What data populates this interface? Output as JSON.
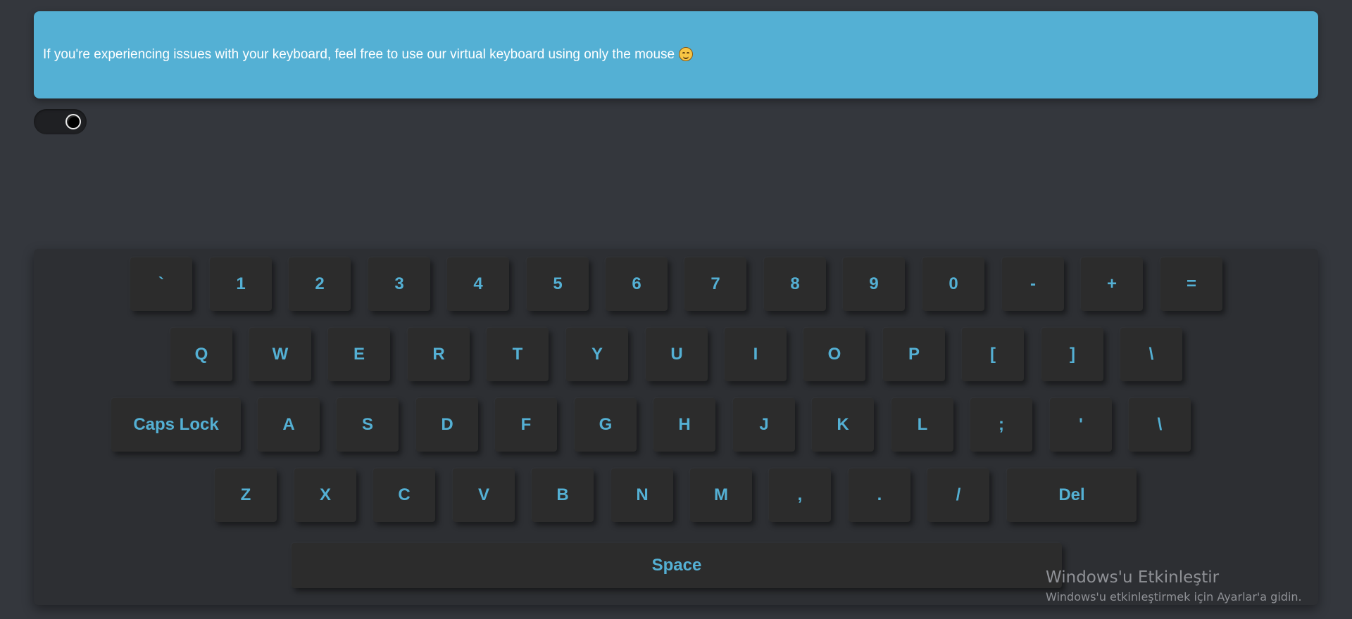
{
  "banner": {
    "message": "If you're experiencing issues with your keyboard, feel free to use our virtual keyboard using only the mouse",
    "emoji_icon": "smiling-face-emoji"
  },
  "toggle": {
    "state": "on",
    "icon": "toggle-switch"
  },
  "keyboard": {
    "rows": [
      [
        "`",
        "1",
        "2",
        "3",
        "4",
        "5",
        "6",
        "7",
        "8",
        "9",
        "0",
        "-",
        "+",
        "="
      ],
      [
        "Q",
        "W",
        "E",
        "R",
        "T",
        "Y",
        "U",
        "I",
        "O",
        "P",
        "[",
        "]",
        "\\"
      ],
      [
        "Caps Lock",
        "A",
        "S",
        "D",
        "F",
        "G",
        "H",
        "J",
        "K",
        "L",
        ";",
        "'",
        "\\"
      ],
      [
        "Z",
        "X",
        "C",
        "V",
        "B",
        "N",
        "M",
        ",",
        ".",
        "/",
        "Del"
      ],
      [
        "Space"
      ]
    ]
  },
  "watermark": {
    "title": "Windows'u Etkinleştir",
    "subtitle": "Windows'u etkinleştirmek için Ayarlar'a gidin."
  },
  "colors": {
    "background": "#34373d",
    "banner": "#54b0d4",
    "key_background": "#2c2c2c",
    "key_text": "#54b0d4"
  }
}
